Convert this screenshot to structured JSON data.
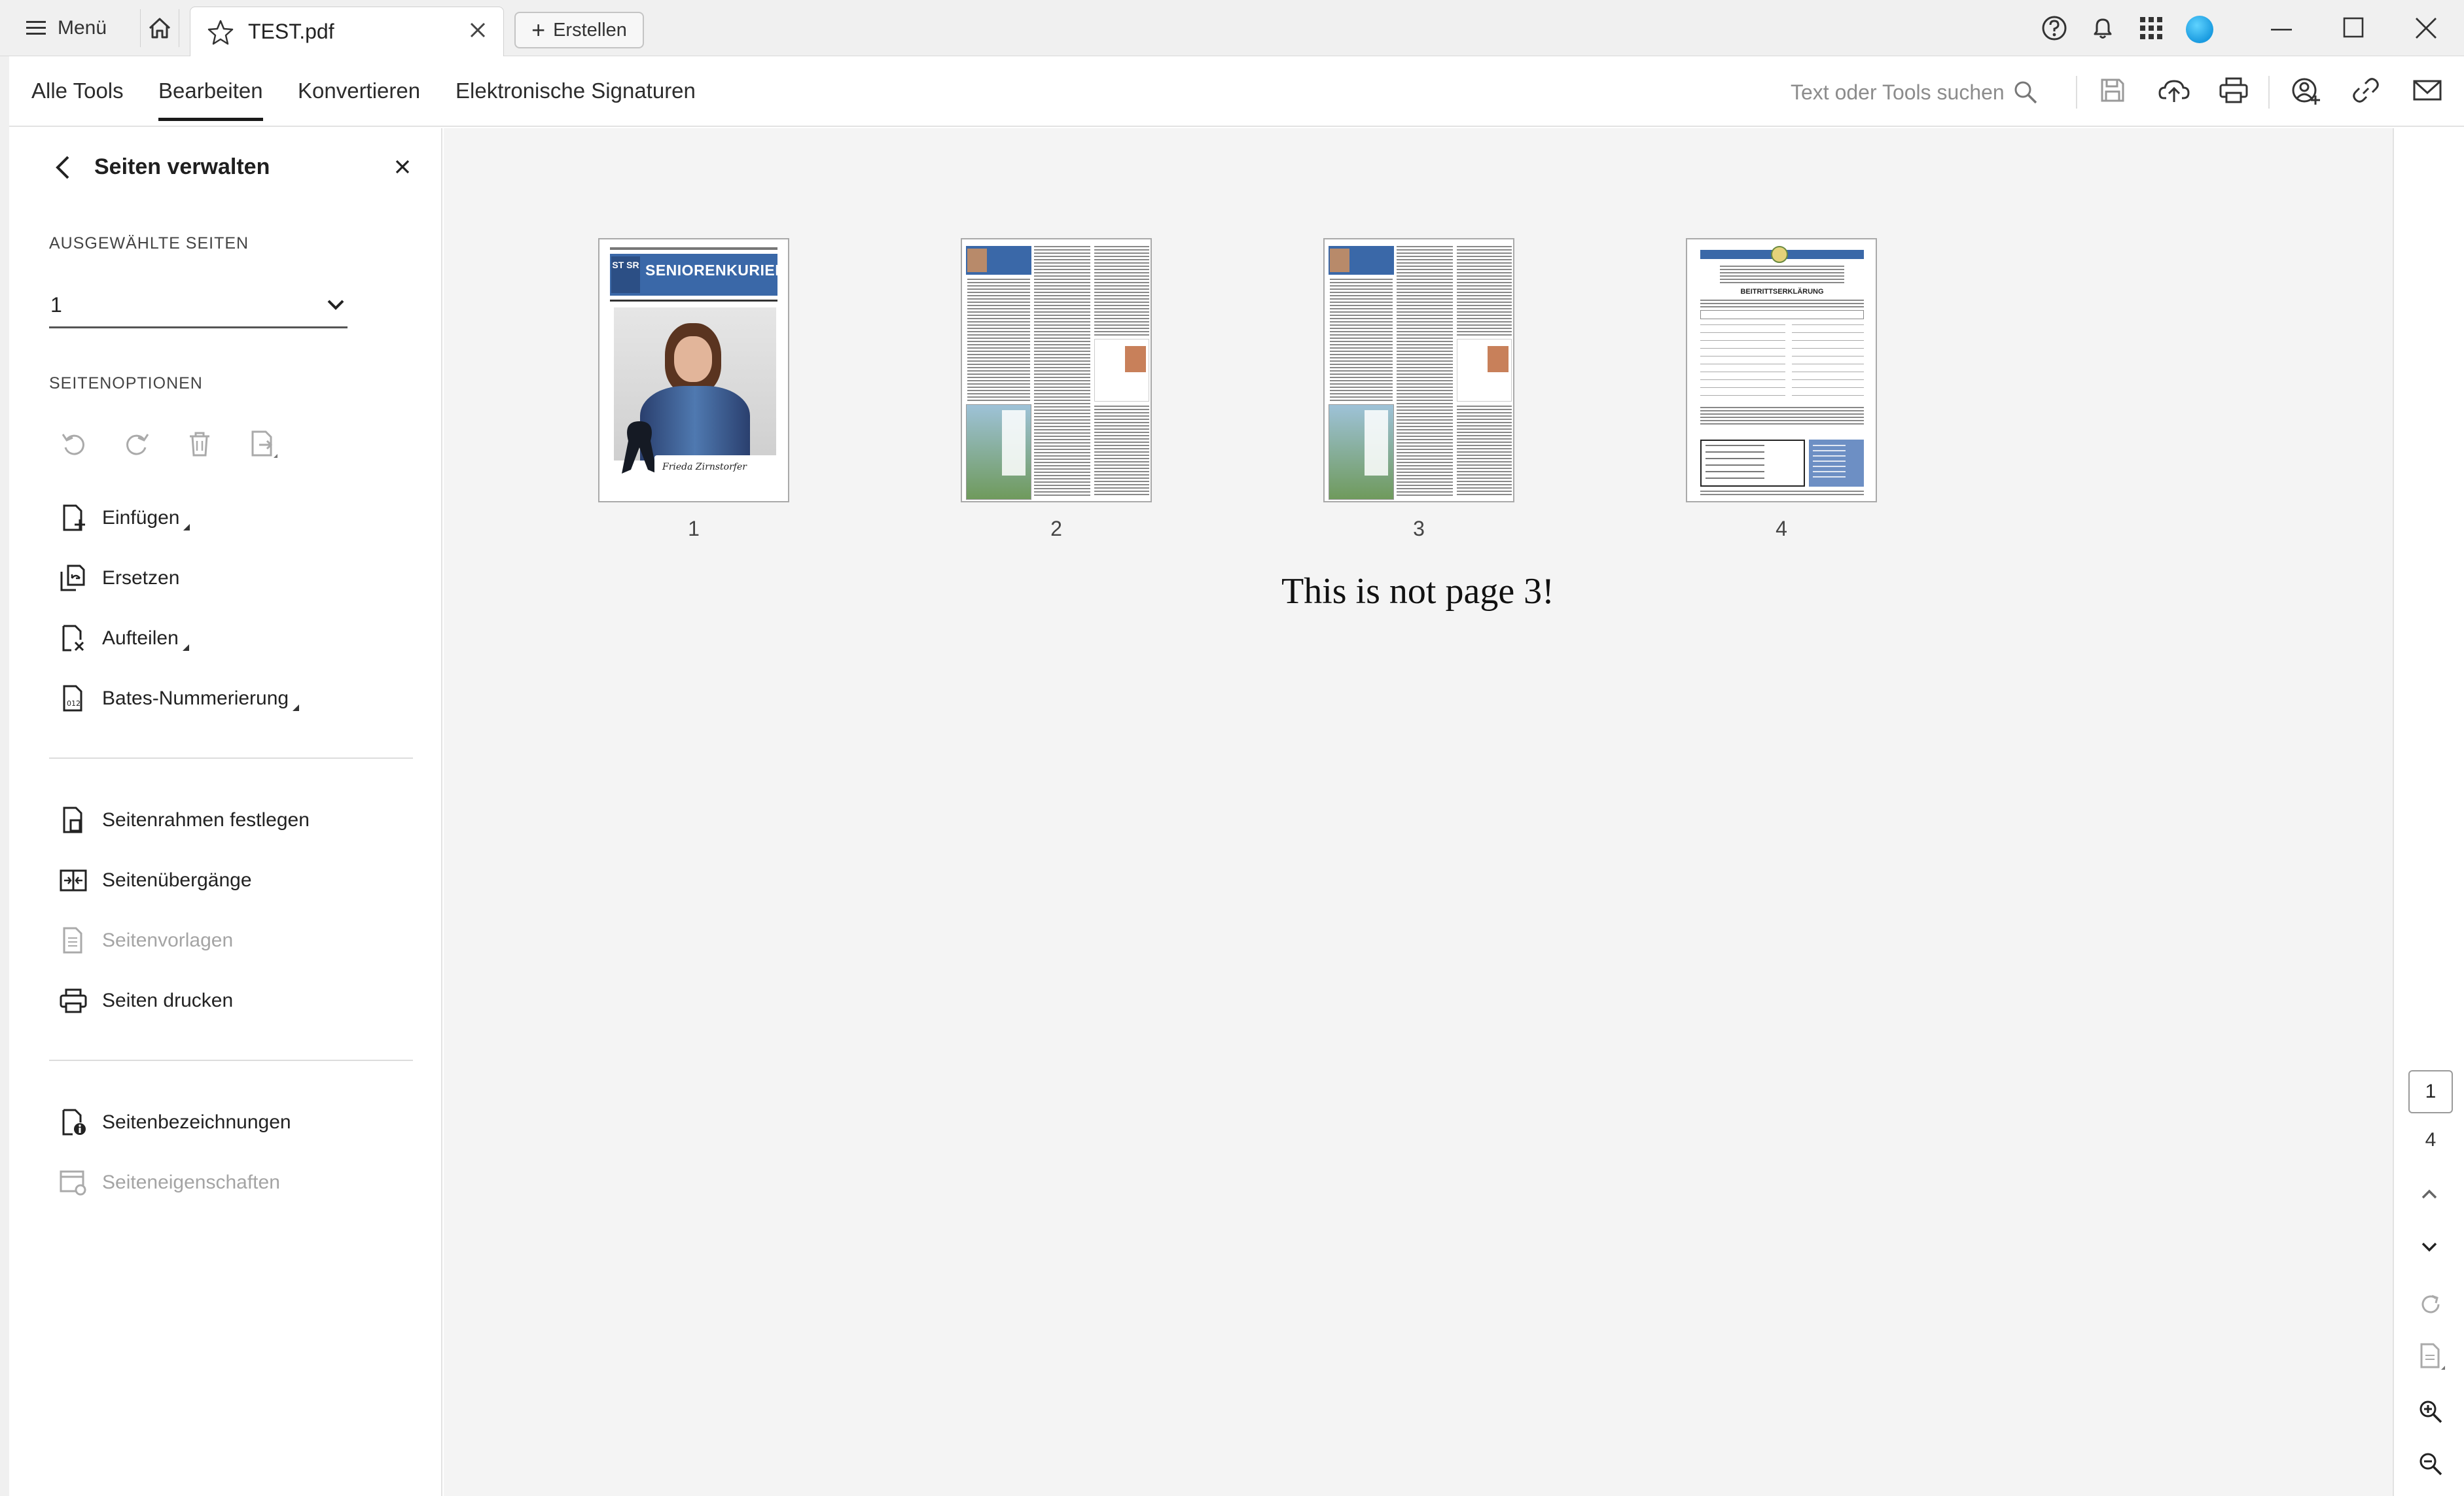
{
  "titlebar": {
    "menu_label": "Menü",
    "tab_title": "TEST.pdf",
    "create_label": "Erstellen"
  },
  "toolbar": {
    "tabs": [
      {
        "label": "Alle Tools",
        "active": false
      },
      {
        "label": "Bearbeiten",
        "active": true
      },
      {
        "label": "Konvertieren",
        "active": false
      },
      {
        "label": "Elektronische Signaturen",
        "active": false
      }
    ],
    "search_placeholder": "Text oder Tools suchen"
  },
  "panel": {
    "title": "Seiten verwalten",
    "selected_pages_label": "AUSGEWÄHLTE SEITEN",
    "selected_pages_value": "1",
    "page_options_label": "SEITENOPTIONEN",
    "items": [
      {
        "label": "Einfügen",
        "icon": "insert-page-icon",
        "flyout": true,
        "disabled": false
      },
      {
        "label": "Ersetzen",
        "icon": "replace-page-icon",
        "flyout": false,
        "disabled": false
      },
      {
        "label": "Aufteilen",
        "icon": "split-page-icon",
        "flyout": true,
        "disabled": false
      },
      {
        "label": "Bates-Nummerierung",
        "icon": "bates-numbering-icon",
        "flyout": true,
        "disabled": false
      },
      {
        "label": "Seitenrahmen festlegen",
        "icon": "page-box-icon",
        "flyout": false,
        "disabled": false
      },
      {
        "label": "Seitenübergänge",
        "icon": "page-transitions-icon",
        "flyout": false,
        "disabled": false
      },
      {
        "label": "Seitenvorlagen",
        "icon": "page-templates-icon",
        "flyout": false,
        "disabled": true
      },
      {
        "label": "Seiten drucken",
        "icon": "print-pages-icon",
        "flyout": false,
        "disabled": false
      },
      {
        "label": "Seitenbezeichnungen",
        "icon": "page-labels-icon",
        "flyout": false,
        "disabled": false
      },
      {
        "label": "Seiteneigenschaften",
        "icon": "page-properties-icon",
        "flyout": false,
        "disabled": true
      }
    ]
  },
  "thumbnails": [
    {
      "number": "1",
      "cover_title": "SENIORENKURIER",
      "cover_logo": "ST SR",
      "signature": "Frieda Zirnstorfer"
    },
    {
      "number": "2"
    },
    {
      "number": "3"
    },
    {
      "number": "4",
      "form_title": "BEITRITTSERKLÄRUNG"
    }
  ],
  "caption": "This is not page 3!",
  "pager": {
    "current": "1",
    "total": "4"
  },
  "colors": {
    "accent_blue": "#3a68a8",
    "chrome": "#f0f0f0",
    "canvas": "#f4f4f4"
  }
}
